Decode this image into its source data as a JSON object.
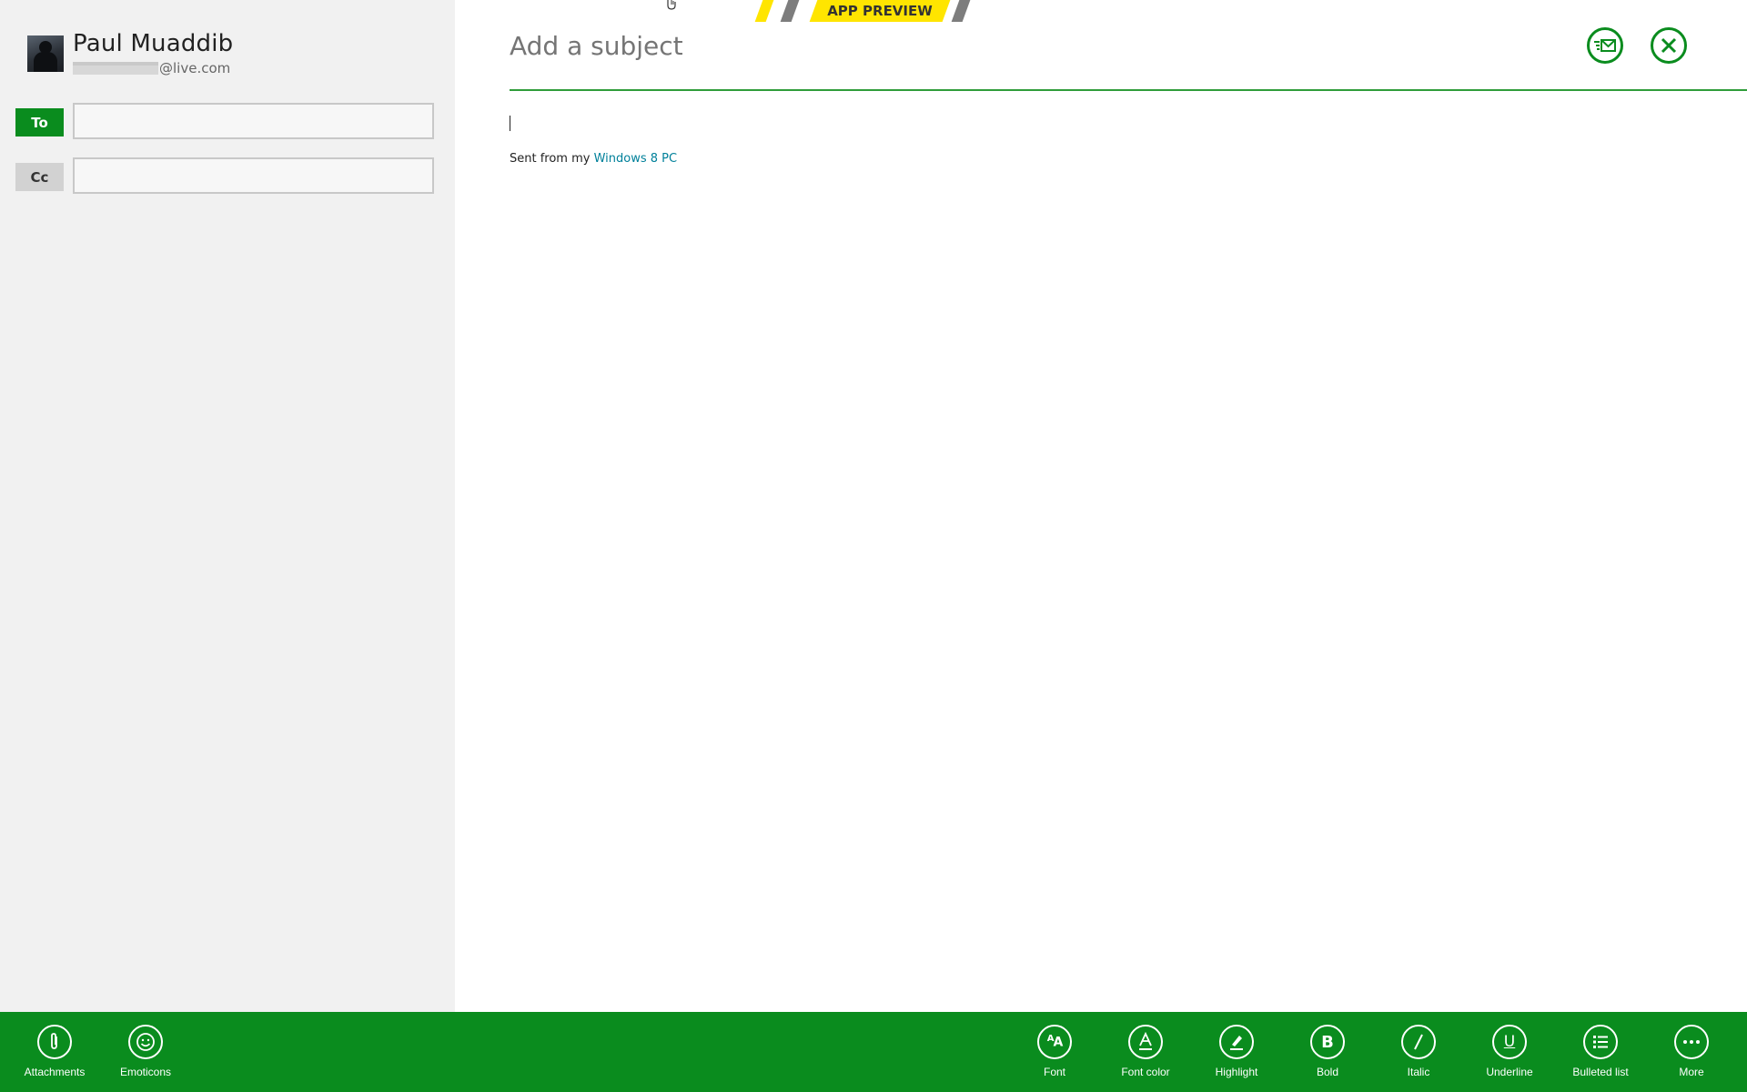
{
  "banner": {
    "text": "APP PREVIEW"
  },
  "account": {
    "name": "Paul Muaddib",
    "email_visible_suffix": "@live.com"
  },
  "recipients": {
    "to_label": "To",
    "to_value": "",
    "cc_label": "Cc",
    "cc_value": ""
  },
  "compose": {
    "subject_placeholder": "Add a subject",
    "body_text": "",
    "signature_prefix": "Sent from my ",
    "signature_link": "Windows 8 PC"
  },
  "header_actions": {
    "send_icon": "send-mail-icon",
    "close_icon": "close-icon"
  },
  "app_bar": {
    "left": [
      {
        "label": "Attachments",
        "icon": "paperclip-icon"
      },
      {
        "label": "Emoticons",
        "icon": "smiley-icon"
      }
    ],
    "right": [
      {
        "label": "Font",
        "icon": "font-icon"
      },
      {
        "label": "Font color",
        "icon": "font-color-icon"
      },
      {
        "label": "Highlight",
        "icon": "highlight-icon"
      },
      {
        "label": "Bold",
        "icon": "bold-icon"
      },
      {
        "label": "Italic",
        "icon": "italic-icon"
      },
      {
        "label": "Underline",
        "icon": "underline-icon"
      },
      {
        "label": "Bulleted list",
        "icon": "bulleted-list-icon"
      },
      {
        "label": "More",
        "icon": "more-icon"
      }
    ]
  },
  "colors": {
    "accent": "#0a8c1e",
    "banner_yellow": "#ffe500",
    "link": "#00809a",
    "left_pane_bg": "#f1f1f1"
  }
}
